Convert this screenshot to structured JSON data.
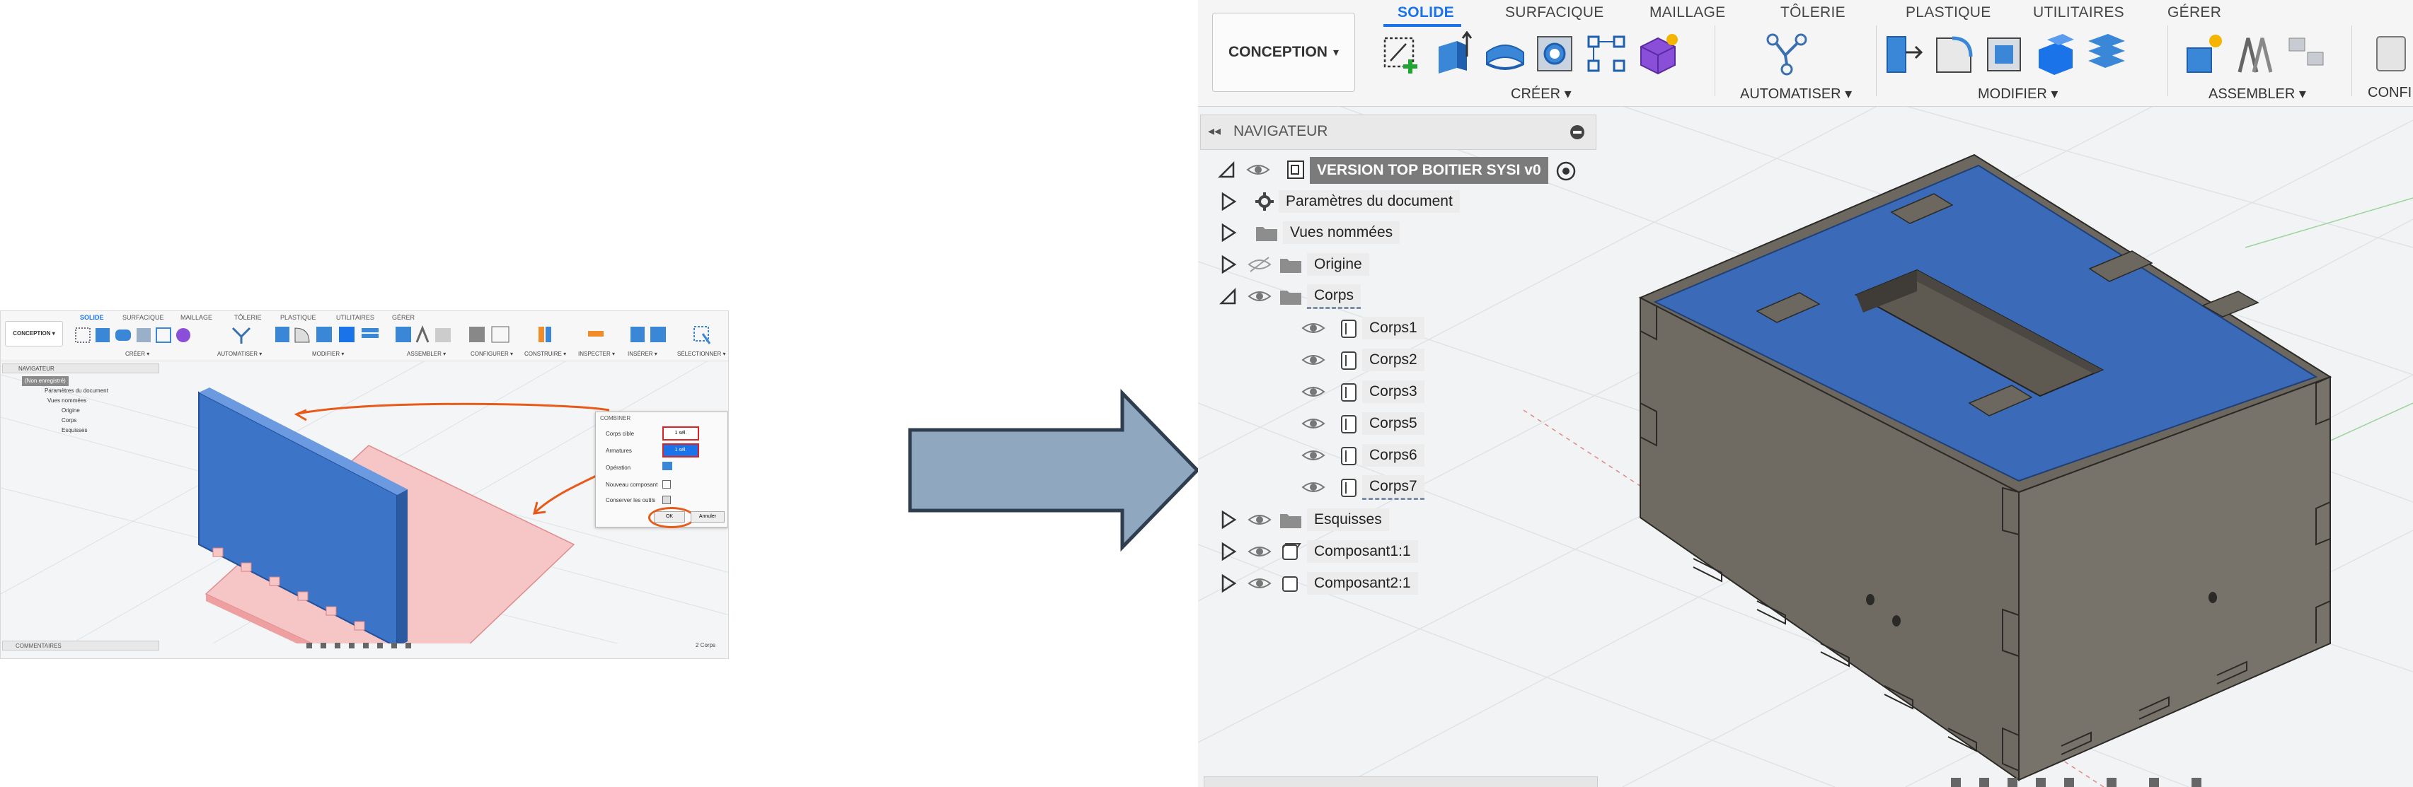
{
  "small_screenshot": {
    "conception_label": "CONCEPTION ▾",
    "tabs": [
      "SOLIDE",
      "SURFACIQUE",
      "MAILLAGE",
      "TÔLERIE",
      "PLASTIQUE",
      "UTILITAIRES",
      "GÉRER"
    ],
    "groups": [
      "CRÉER ▾",
      "AUTOMATISER ▾",
      "MODIFIER ▾",
      "ASSEMBLER ▾",
      "CONFIGURER ▾",
      "CONSTRUIRE ▾",
      "INSPECTER ▾",
      "INSÉRER ▾",
      "SÉLECTIONNER ▾"
    ],
    "navigator_title": "NAVIGATEUR",
    "tree": [
      "(Non enregistré)",
      "Paramètres du document",
      "Vues nommées",
      "Origine",
      "Corps",
      "Esquisses"
    ],
    "dialog": {
      "title": "COMBINER",
      "rows": [
        "Corps cible",
        "Armatures",
        "Opération",
        "Nouveau composant",
        "Conserver les outils"
      ],
      "target_value": "1 sél.",
      "tool_value": "1 sél.",
      "ok": "OK",
      "cancel": "Annuler"
    },
    "comments": "COMMENTAIRES",
    "status": "2 Corps"
  },
  "large_screenshot": {
    "conception_label": "CONCEPTION",
    "tabs": [
      "SOLIDE",
      "SURFACIQUE",
      "MAILLAGE",
      "TÔLERIE",
      "PLASTIQUE",
      "UTILITAIRES",
      "GÉRER"
    ],
    "active_tab": "SOLIDE",
    "groups": {
      "create": "CRÉER ▾",
      "automate": "AUTOMATISER ▾",
      "modify": "MODIFIER ▾",
      "assemble": "ASSEMBLER ▾",
      "configure": "CONFI"
    },
    "navigator": {
      "title": "NAVIGATEUR",
      "root": "VERSION TOP BOITIER SYSI v0",
      "items": [
        {
          "label": "Paramètres du document",
          "icon": "gear-icon"
        },
        {
          "label": "Vues nommées",
          "icon": "folder-icon"
        },
        {
          "label": "Origine",
          "icon": "folder-icon"
        },
        {
          "label": "Corps",
          "icon": "folder-icon"
        }
      ],
      "bodies": [
        "Corps1",
        "Corps2",
        "Corps3",
        "Corps5",
        "Corps6",
        "Corps7"
      ],
      "after": [
        {
          "label": "Esquisses",
          "icon": "folder-icon"
        },
        {
          "label": "Composant1:1",
          "icon": "component-icon"
        },
        {
          "label": "Composant2:1",
          "icon": "component-icon"
        }
      ]
    },
    "colors": {
      "accent": "#1a73e8",
      "body_blue": "#3b6bb8",
      "box_grey": "#6f6b63"
    }
  }
}
